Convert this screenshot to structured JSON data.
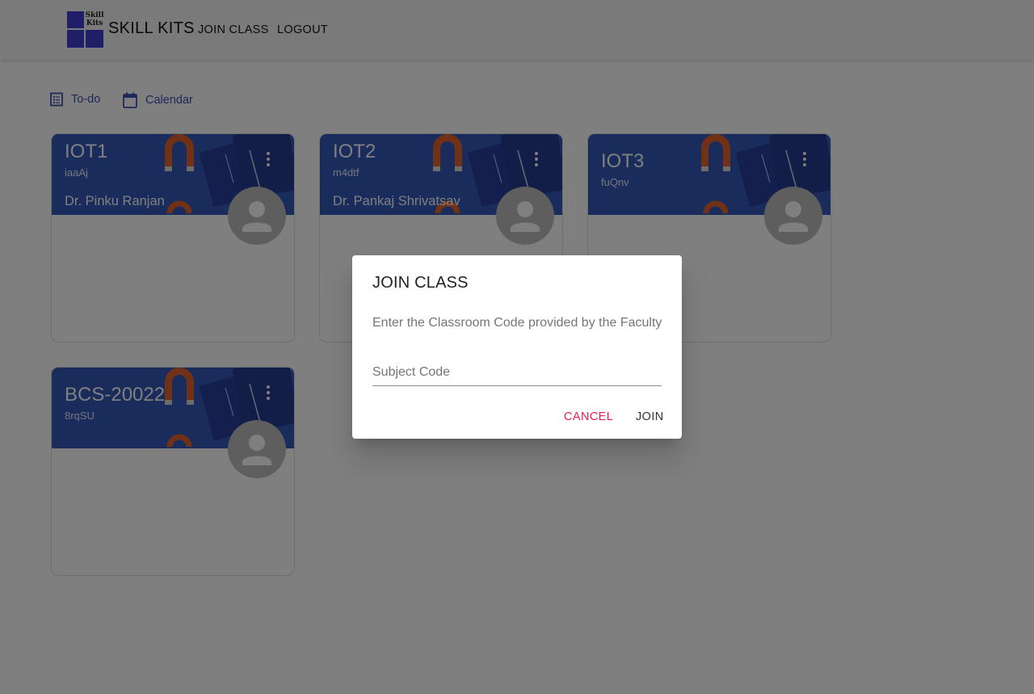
{
  "header": {
    "logo_text_1": "Skill",
    "logo_text_2": "Kits",
    "brand": "SKILL KITS",
    "nav": [
      "JOIN CLASS",
      "LOGOUT"
    ]
  },
  "subnav": {
    "todo_label": "To-do",
    "calendar_label": "Calendar"
  },
  "classes": [
    {
      "title": "IOT1",
      "code": "iaaAj",
      "teacher": "Dr. Pinku Ranjan"
    },
    {
      "title": "IOT2",
      "code": "m4dtf",
      "teacher": "Dr. Pankaj Shrivatsav"
    },
    {
      "title": "IOT3",
      "code": "fuQnv",
      "teacher": ""
    },
    {
      "title": "BCS-20022",
      "code": "8rqSU",
      "teacher": ""
    }
  ],
  "dialog": {
    "title": "JOIN CLASS",
    "text": "Enter the Classroom Code provided by the Faculty",
    "input_placeholder": "Subject Code",
    "input_value": "",
    "cancel_label": "CANCEL",
    "join_label": "JOIN"
  },
  "colors": {
    "primary": "#3f51b5",
    "banner": "#3558b8",
    "cancel": "#e91e4f"
  }
}
